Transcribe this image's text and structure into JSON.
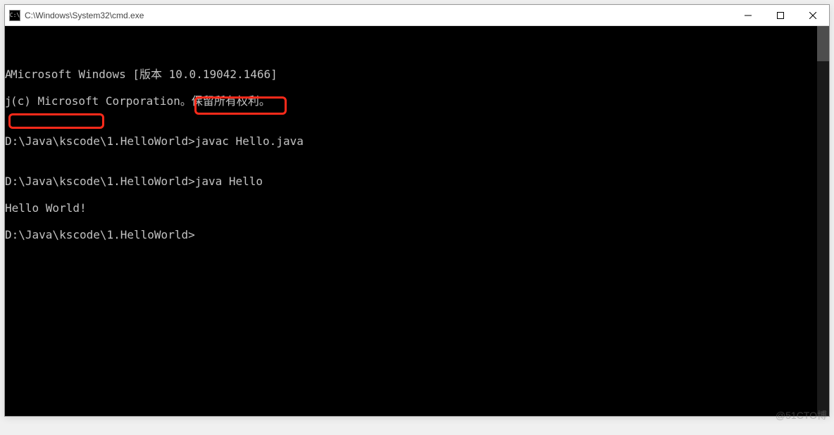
{
  "window": {
    "title": "C:\\Windows\\System32\\cmd.exe",
    "icon_label": "C:\\"
  },
  "console": {
    "line1_partial": "A",
    "line1": "Microsoft Windows [版本 10.0.19042.1466]",
    "line2_partial": "j.",
    "line2": "(c) Microsoft Corporation。保留所有权利。",
    "blank": "",
    "line3": "D:\\Java\\kscode\\1.HelloWorld>javac Hello.java",
    "line4_prompt": "D:\\Java\\kscode\\1.HelloWorld>",
    "line4_cmd": "java Hello",
    "line5": "Hello World!",
    "line6": "D:\\Java\\kscode\\1.HelloWorld>"
  },
  "watermark": "@51CTO博"
}
